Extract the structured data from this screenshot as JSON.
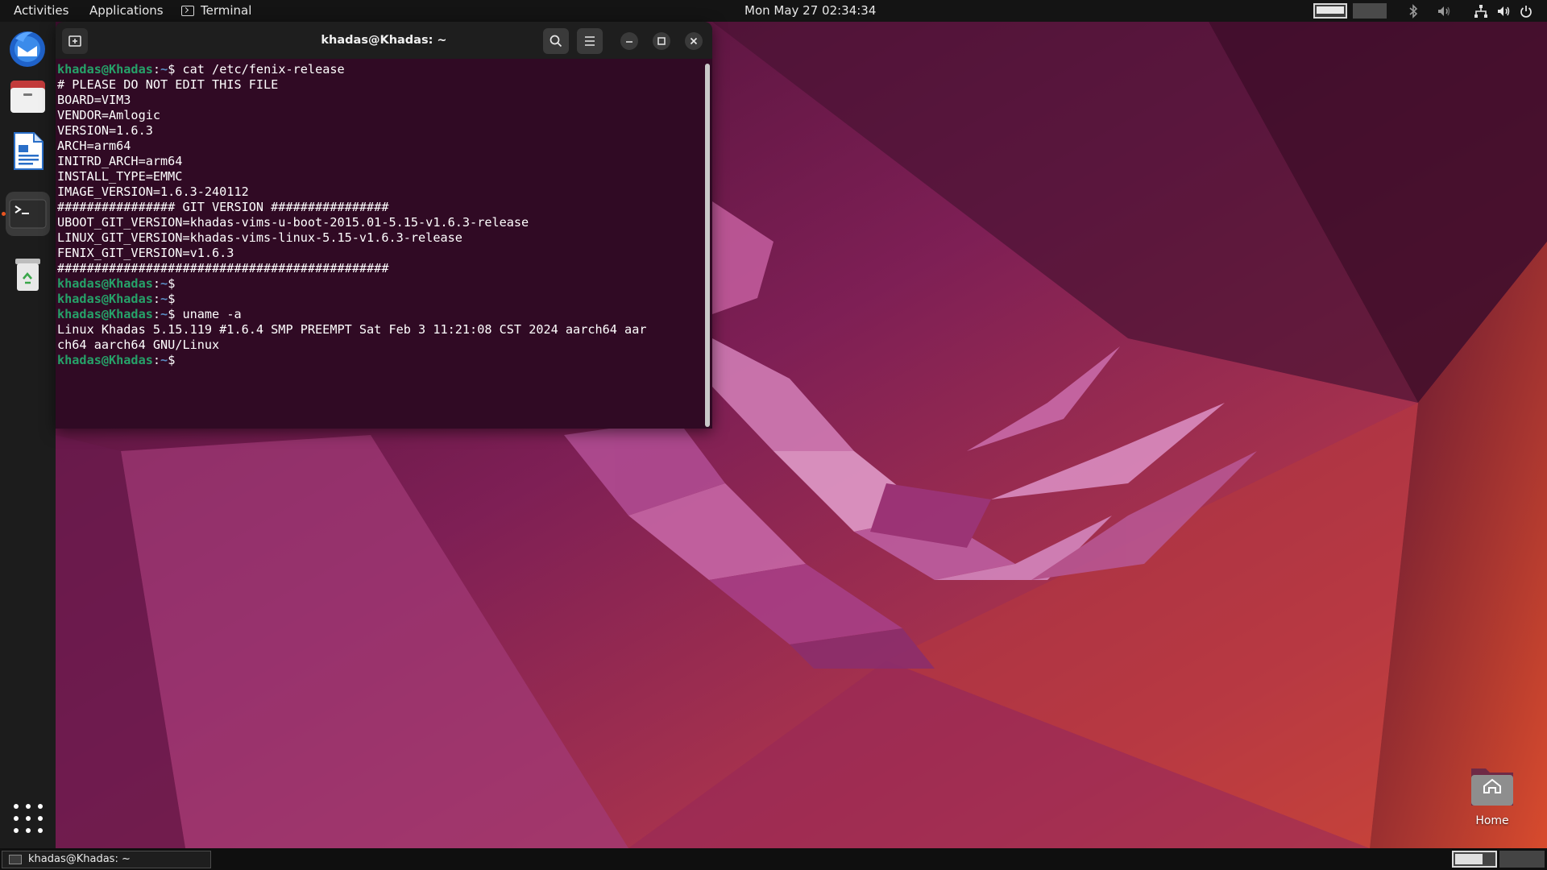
{
  "top_bar": {
    "activities": "Activities",
    "applications": "Applications",
    "focused_app": "Terminal",
    "clock": "Mon May 27  02:34:34",
    "status_icons": [
      "bluetooth-icon",
      "speaker-low-icon",
      "network-icon",
      "volume-icon",
      "power-icon"
    ]
  },
  "dock": {
    "apps": [
      {
        "name": "Thunderbird",
        "icon": "thunderbird-icon"
      },
      {
        "name": "Files",
        "icon": "files-icon"
      },
      {
        "name": "LibreOffice Writer",
        "icon": "writer-icon"
      },
      {
        "name": "Terminal",
        "icon": "terminal-icon",
        "running": true
      },
      {
        "name": "Trash",
        "icon": "trash-icon"
      }
    ],
    "show_apps_icon": "app-grid-icon"
  },
  "terminal": {
    "title": "khadas@Khadas: ~",
    "prompt_user": "khadas@Khadas",
    "prompt_path": "~",
    "lines": [
      {
        "type": "cmd",
        "text": "cat /etc/fenix-release"
      },
      {
        "type": "out",
        "text": "# PLEASE DO NOT EDIT THIS FILE"
      },
      {
        "type": "out",
        "text": "BOARD=VIM3"
      },
      {
        "type": "out",
        "text": "VENDOR=Amlogic"
      },
      {
        "type": "out",
        "text": "VERSION=1.6.3"
      },
      {
        "type": "out",
        "text": "ARCH=arm64"
      },
      {
        "type": "out",
        "text": "INITRD_ARCH=arm64"
      },
      {
        "type": "out",
        "text": "INSTALL_TYPE=EMMC"
      },
      {
        "type": "out",
        "text": "IMAGE_VERSION=1.6.3-240112"
      },
      {
        "type": "out",
        "text": "################ GIT VERSION ################"
      },
      {
        "type": "out",
        "text": "UBOOT_GIT_VERSION=khadas-vims-u-boot-2015.01-5.15-v1.6.3-release"
      },
      {
        "type": "out",
        "text": "LINUX_GIT_VERSION=khadas-vims-linux-5.15-v1.6.3-release"
      },
      {
        "type": "out",
        "text": "FENIX_GIT_VERSION=v1.6.3"
      },
      {
        "type": "out",
        "text": "#############################################"
      },
      {
        "type": "cmd",
        "text": ""
      },
      {
        "type": "cmd",
        "text": ""
      },
      {
        "type": "cmd",
        "text": "uname -a"
      },
      {
        "type": "out",
        "text": "Linux Khadas 5.15.119 #1.6.4 SMP PREEMPT Sat Feb 3 11:21:08 CST 2024 aarch64 aar"
      },
      {
        "type": "out",
        "text": "ch64 aarch64 GNU/Linux"
      },
      {
        "type": "cmd",
        "text": ""
      }
    ],
    "colors": {
      "background": "#300a24",
      "prompt_user": "#26a269",
      "prompt_path": "#5a8cc2",
      "text": "#ffffff"
    }
  },
  "desktop": {
    "home_label": "Home"
  },
  "taskbar": {
    "window_title": "khadas@Khadas: ~"
  },
  "theme": {
    "accent": "#e95420"
  }
}
